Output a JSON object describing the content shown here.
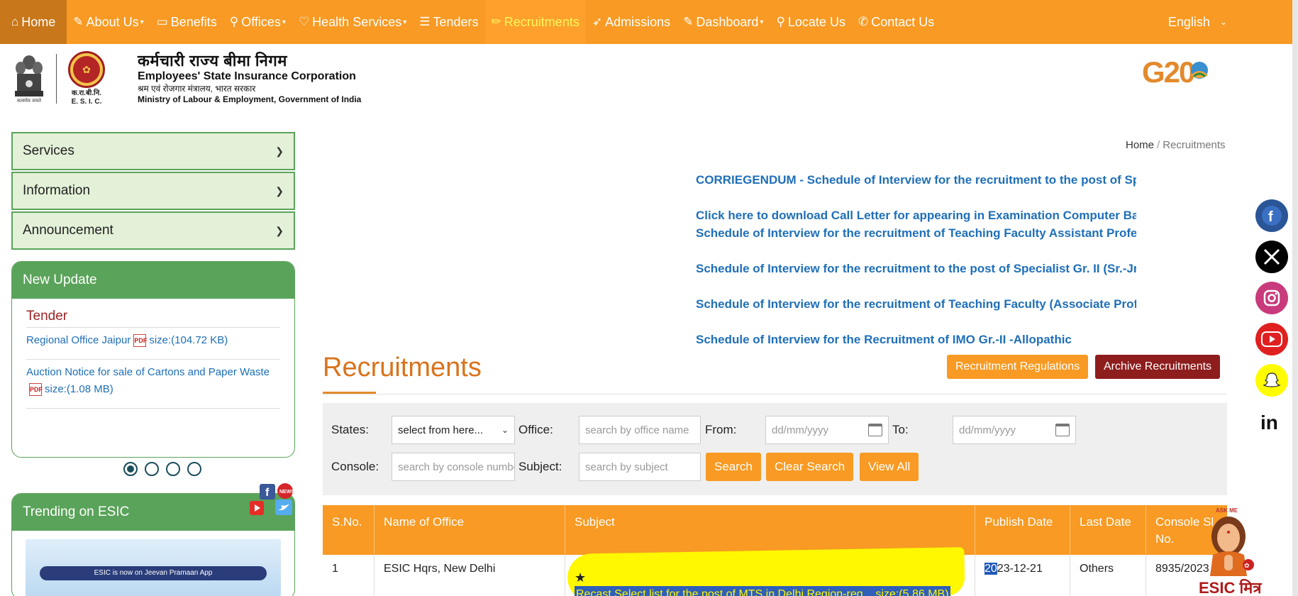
{
  "nav": {
    "items": [
      {
        "label": "Home",
        "icon": "home-icon",
        "caret": false
      },
      {
        "label": "About Us",
        "icon": "edit-icon",
        "caret": true
      },
      {
        "label": "Benefits",
        "icon": "money-icon",
        "caret": false
      },
      {
        "label": "Offices",
        "icon": "map-pin-icon",
        "caret": true
      },
      {
        "label": "Health Services",
        "icon": "heartbeat-icon",
        "caret": true
      },
      {
        "label": "Tenders",
        "icon": "list-icon",
        "caret": false
      },
      {
        "label": "Recruitments",
        "icon": "pencil-icon",
        "caret": false
      },
      {
        "label": "Admissions",
        "icon": "rocket-icon",
        "caret": false
      },
      {
        "label": "Dashboard",
        "icon": "edit-icon",
        "caret": true
      },
      {
        "label": "Locate Us",
        "icon": "map-pin-icon",
        "caret": false
      },
      {
        "label": "Contact Us",
        "icon": "phone-icon",
        "caret": false
      }
    ],
    "language": "English",
    "active_color": "#fff95a",
    "bar_color": "#f89a23"
  },
  "brand": {
    "hindi_name": "कर्मचारी राज्य बीमा निगम",
    "english_name": "Employees' State Insurance Corporation",
    "hindi_ministry": "श्रम एवं रोजगार मंत्रालय, भारत सरकार",
    "english_ministry": "Ministry of Labour & Employment, Government of India",
    "short_hindi": "क.रा.बी.नि.",
    "short_english": "E. S. I. C.",
    "emblem_caption": "सत्यमेव जयते",
    "g20_text": "G20"
  },
  "sidebar": {
    "accordions": [
      "Services",
      "Information",
      "Announcement"
    ],
    "new_update": {
      "title": "New Update",
      "section": "Tender",
      "items": [
        {
          "text": "Regional Office Jaipur",
          "size": "size:(104.72 KB)"
        },
        {
          "text": "Auction Notice for sale of Cartons and Paper Waste",
          "size": "size:(1.08 MB)"
        }
      ]
    },
    "trending": {
      "title": "Trending on ESIC",
      "banner_text": "ESIC is now on Jeevan Pramaan App"
    }
  },
  "breadcrumb": {
    "home": "Home",
    "separator": "/",
    "current": "Recruitments"
  },
  "marquee": [
    "CORRIEGENDUM - Schedule of Interview for the recruitment to the post of Spec",
    "Click here to download Call Letter for appearing in Examination Computer Based T",
    "Schedule of Interview for the recruitment of Teaching Faculty Assistant Professor",
    "Schedule of Interview for the recruitment to the post of Specialist Gr. II (Sr.-Jr. Sca",
    "Schedule of Interview for the recruitment of Teaching Faculty (Associate Professo",
    "Schedule of Interview for the Recruitment of IMO Gr.-II -Allopathic"
  ],
  "page": {
    "title": "Recruitments",
    "btn_regulations": "Recruitment Regulations",
    "btn_archive": "Archive Recruitments"
  },
  "filters": {
    "states_label": "States:",
    "states_value": "select from here...",
    "office_label": "Office:",
    "office_placeholder": "search by office name",
    "from_label": "From:",
    "from_placeholder": "dd/mm/yyyy",
    "to_label": "To:",
    "to_placeholder": "dd/mm/yyyy",
    "console_label": "Console:",
    "console_placeholder": "search by console number",
    "subject_label": "Subject:",
    "subject_placeholder": "search by subject",
    "search_btn": "Search",
    "clear_btn": "Clear Search",
    "viewall_btn": "View All"
  },
  "table": {
    "headers": [
      "S.No.",
      "Name of Office",
      "Subject",
      "Publish Date",
      "Last Date",
      "Console Sl. No."
    ],
    "rows": [
      {
        "sno": "1",
        "office": "ESIC Hqrs, New Delhi",
        "subject": "Recast Select list for the post of MTS in Delhi Region-reg.",
        "size": "size:(5.86 MB)",
        "publish_sel": "20",
        "publish_rest": "23-12-21",
        "last": "Others",
        "console": "8935/2023"
      }
    ]
  },
  "social": [
    "facebook-icon",
    "x-icon",
    "instagram-icon",
    "youtube-icon",
    "snapchat-icon",
    "linkedin-icon"
  ],
  "mitra": {
    "top": "ASK ME",
    "label": "ESIC मित्र"
  }
}
